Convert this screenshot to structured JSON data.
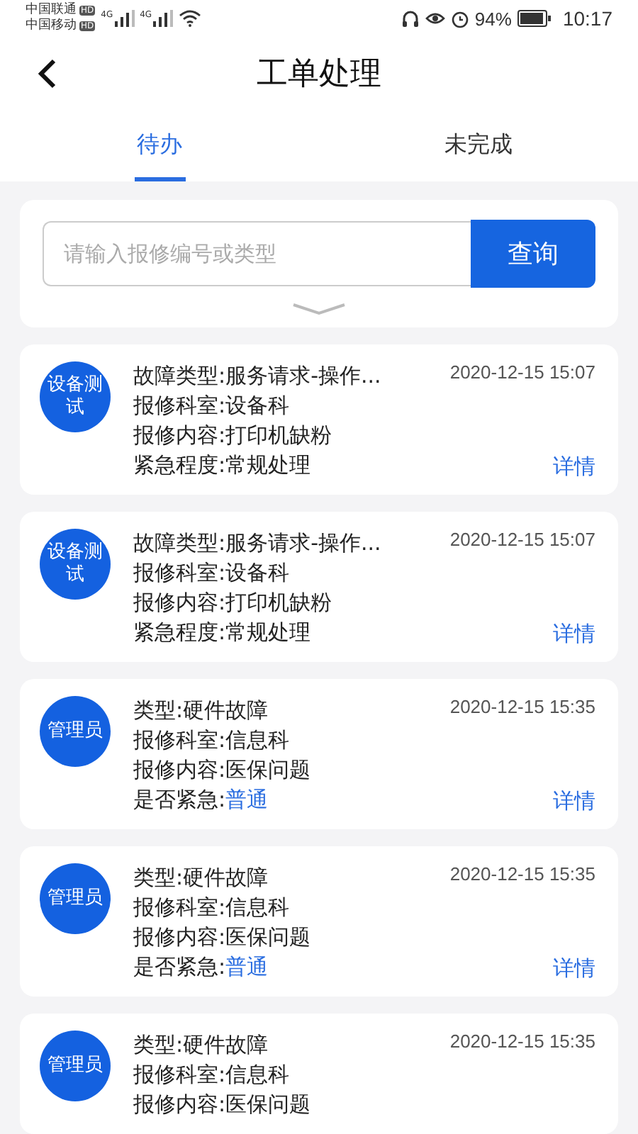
{
  "status_bar": {
    "carriers": [
      {
        "name": "中国联通",
        "badge": "HD",
        "network": "4G"
      },
      {
        "name": "中国移动",
        "badge": "HD",
        "network": "4G"
      }
    ],
    "battery_text": "94%",
    "time": "10:17"
  },
  "header": {
    "title": "工单处理"
  },
  "tabs": [
    {
      "label": "待办",
      "selected": true
    },
    {
      "label": "未完成",
      "selected": false
    }
  ],
  "search": {
    "placeholder": "请输入报修编号或类型",
    "button": "查询"
  },
  "orders": [
    {
      "avatar": "设备测试",
      "time": "2020-12-15 15:07",
      "action": "详情",
      "lines": [
        {
          "label": "故障类型:",
          "value": "服务请求-操作...",
          "highlight": false
        },
        {
          "label": "报修科室:",
          "value": "设备科",
          "highlight": false
        },
        {
          "label": "报修内容:",
          "value": "打印机缺粉",
          "highlight": false
        },
        {
          "label": "紧急程度:",
          "value": "常规处理",
          "highlight": false
        }
      ]
    },
    {
      "avatar": "设备测试",
      "time": "2020-12-15 15:07",
      "action": "详情",
      "lines": [
        {
          "label": "故障类型:",
          "value": "服务请求-操作...",
          "highlight": false
        },
        {
          "label": "报修科室:",
          "value": "设备科",
          "highlight": false
        },
        {
          "label": "报修内容:",
          "value": "打印机缺粉",
          "highlight": false
        },
        {
          "label": "紧急程度:",
          "value": "常规处理",
          "highlight": false
        }
      ]
    },
    {
      "avatar": "管理员",
      "time": "2020-12-15 15:35",
      "action": "详情",
      "lines": [
        {
          "label": "类型:",
          "value": "硬件故障",
          "highlight": false
        },
        {
          "label": "报修科室:",
          "value": "信息科",
          "highlight": false
        },
        {
          "label": "报修内容:",
          "value": "医保问题",
          "highlight": false
        },
        {
          "label": "是否紧急:",
          "value": "普通",
          "highlight": true
        }
      ]
    },
    {
      "avatar": "管理员",
      "time": "2020-12-15 15:35",
      "action": "详情",
      "lines": [
        {
          "label": "类型:",
          "value": "硬件故障",
          "highlight": false
        },
        {
          "label": "报修科室:",
          "value": "信息科",
          "highlight": false
        },
        {
          "label": "报修内容:",
          "value": "医保问题",
          "highlight": false
        },
        {
          "label": "是否紧急:",
          "value": "普通",
          "highlight": true
        }
      ]
    },
    {
      "avatar": "管理员",
      "time": "2020-12-15 15:35",
      "lines": [
        {
          "label": "类型:",
          "value": "硬件故障",
          "highlight": false
        },
        {
          "label": "报修科室:",
          "value": "信息科",
          "highlight": false
        },
        {
          "label": "报修内容:",
          "value": "医保问题",
          "highlight": false
        }
      ]
    }
  ]
}
